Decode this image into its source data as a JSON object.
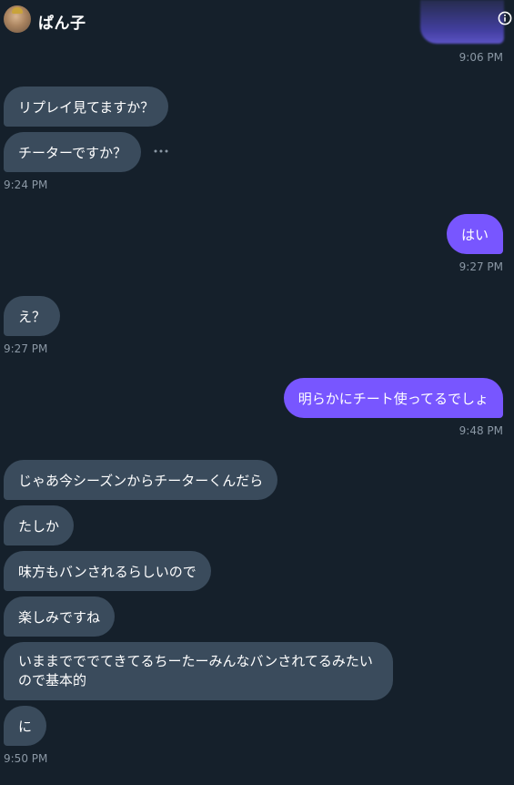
{
  "header": {
    "username": "ぱん子"
  },
  "messages": [
    {
      "text": "リプレイ見てますか？",
      "dir": "in"
    },
    {
      "text": "チーターですか？",
      "dir": "in"
    },
    {
      "text": "はい",
      "dir": "out"
    },
    {
      "text": "え？",
      "dir": "in"
    },
    {
      "text": "明らかにチート使ってるでしょ",
      "dir": "out"
    },
    {
      "text": "じゃあ今シーズンからチーターくんだら",
      "dir": "in"
    },
    {
      "text": "たしか",
      "dir": "in"
    },
    {
      "text": "味方もバンされるらしいので",
      "dir": "in"
    },
    {
      "text": "楽しみですね",
      "dir": "in"
    },
    {
      "text": "いままでででてきてるちーたーみんなバンされてるみたいので基本的",
      "dir": "in"
    },
    {
      "text": "に",
      "dir": "in"
    }
  ],
  "timestamps": [
    "9:06 PM",
    "9:24 PM",
    "9:27 PM",
    "9:27 PM",
    "9:48 PM",
    "9:50 PM"
  ],
  "icons": {
    "info": "info-icon",
    "more": "more-options-icon"
  },
  "colors": {
    "background": "#15202b",
    "incoming_bubble": "#3a4b5c",
    "outgoing_bubble": "#7856ff",
    "timestamp": "#8b98a5"
  }
}
